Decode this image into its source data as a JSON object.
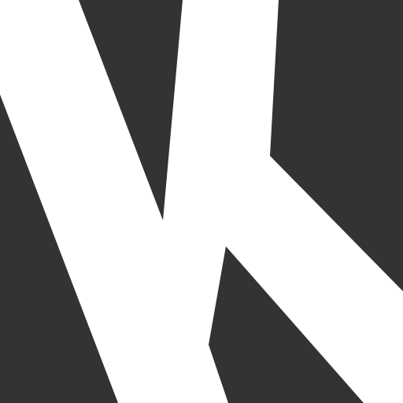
{
  "colors": {
    "dark": "#333333",
    "light": "#ffffff"
  },
  "logo": {
    "icon": "letter-k-icon"
  }
}
